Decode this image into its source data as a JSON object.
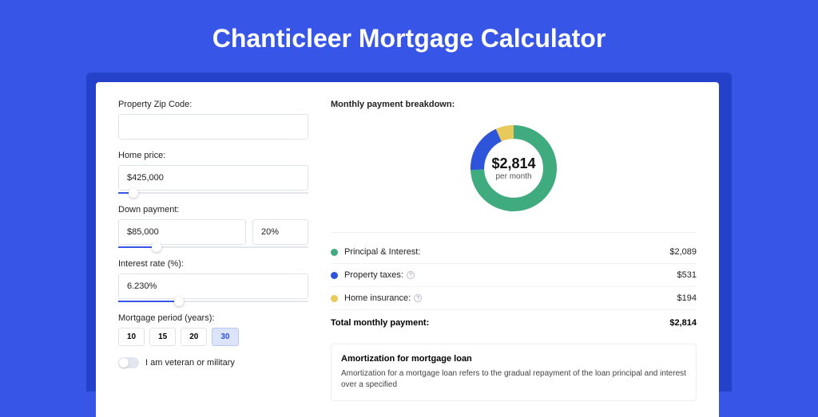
{
  "page": {
    "title": "Chanticleer Mortgage Calculator"
  },
  "form": {
    "zip_label": "Property Zip Code:",
    "zip_value": "",
    "home_price_label": "Home price:",
    "home_price_value": "$425,000",
    "home_price_slider_pct": 8,
    "down_payment_label": "Down payment:",
    "down_payment_value": "$85,000",
    "down_payment_pct_value": "20%",
    "down_payment_slider_pct": 20,
    "interest_label": "Interest rate (%):",
    "interest_value": "6.230%",
    "interest_slider_pct": 32,
    "period_label": "Mortgage period (years):",
    "periods": [
      "10",
      "15",
      "20",
      "30"
    ],
    "period_selected": "30",
    "veteran_label": "I am veteran or military",
    "veteran_on": false
  },
  "breakdown": {
    "title": "Monthly payment breakdown:",
    "amount": "$2,814",
    "amount_sub": "per month",
    "items": [
      {
        "label": "Principal & Interest:",
        "value": "$2,089",
        "color": "d-green",
        "info": false
      },
      {
        "label": "Property taxes:",
        "value": "$531",
        "color": "d-blue",
        "info": true
      },
      {
        "label": "Home insurance:",
        "value": "$194",
        "color": "d-yellow",
        "info": true
      }
    ],
    "total_label": "Total monthly payment:",
    "total_value": "$2,814"
  },
  "chart_data": {
    "type": "pie",
    "title": "Monthly payment breakdown",
    "series": [
      {
        "name": "Principal & Interest",
        "value": 2089,
        "color": "#3fab7f"
      },
      {
        "name": "Property taxes",
        "value": 531,
        "color": "#2e55d9"
      },
      {
        "name": "Home insurance",
        "value": 194,
        "color": "#e8c95c"
      }
    ],
    "total": 2814,
    "center_label": "$2,814",
    "center_sublabel": "per month"
  },
  "amortization": {
    "title": "Amortization for mortgage loan",
    "text": "Amortization for a mortgage loan refers to the gradual repayment of the loan principal and interest over a specified"
  }
}
